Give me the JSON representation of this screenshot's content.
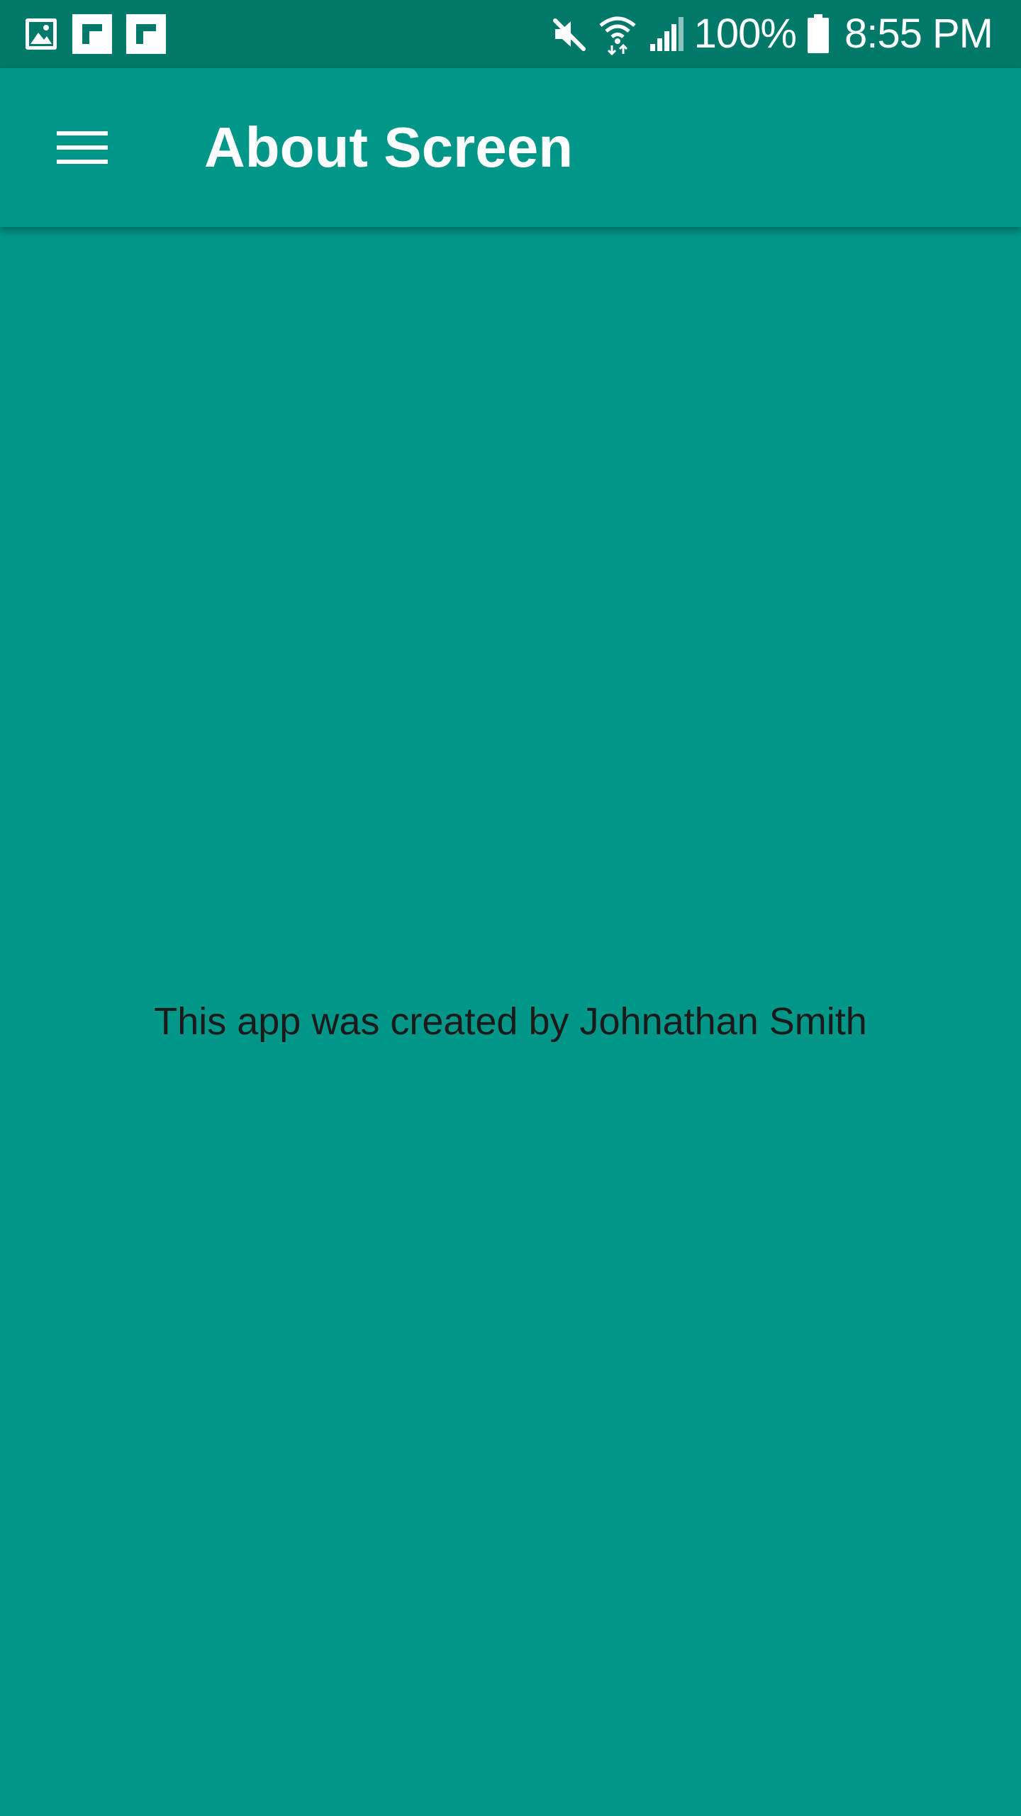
{
  "status_bar": {
    "battery_percent": "100%",
    "time": "8:55 PM",
    "left_icons": [
      "gallery-icon",
      "flipboard-icon",
      "flipboard-icon"
    ],
    "right_icons": [
      "mute-icon",
      "wifi-icon",
      "signal-icon",
      "battery-icon"
    ]
  },
  "app_bar": {
    "menu_icon": "hamburger-menu-icon",
    "title": "About Screen"
  },
  "content": {
    "credit": "This app was created by Johnathan Smith"
  },
  "colors": {
    "primary": "#009688",
    "primary_dark": "#00796b",
    "on_primary": "#ffffff",
    "body_text": "#1a1a1a"
  }
}
